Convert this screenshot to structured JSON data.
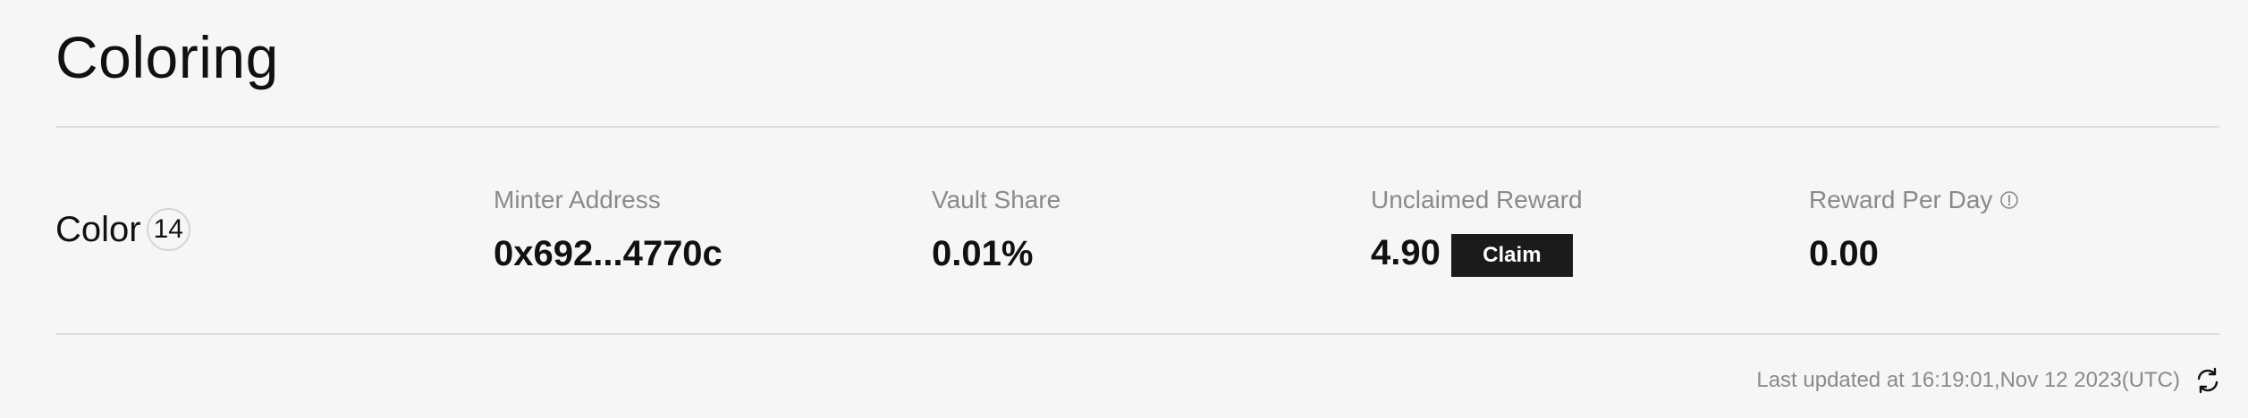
{
  "page": {
    "title": "Coloring"
  },
  "row": {
    "name": "Color",
    "count": "14",
    "minter_address": {
      "label": "Minter Address",
      "value": "0x692...4770c"
    },
    "vault_share": {
      "label": "Vault Share",
      "value": "0.01%"
    },
    "unclaimed_reward": {
      "label": "Unclaimed Reward",
      "value": "4.90",
      "button_label": "Claim"
    },
    "reward_per_day": {
      "label": "Reward Per Day",
      "value": "0.00",
      "icon": "info-icon"
    }
  },
  "footer": {
    "last_updated": "Last updated at 16:19:01,Nov 12 2023(UTC)",
    "refresh_icon": "refresh-icon"
  },
  "colors": {
    "background": "#f6f6f6",
    "text_primary": "#111111",
    "text_muted": "#8a8a8a",
    "divider": "#dcdcdc",
    "button_bg": "#1b1b1b",
    "button_text": "#ffffff"
  }
}
